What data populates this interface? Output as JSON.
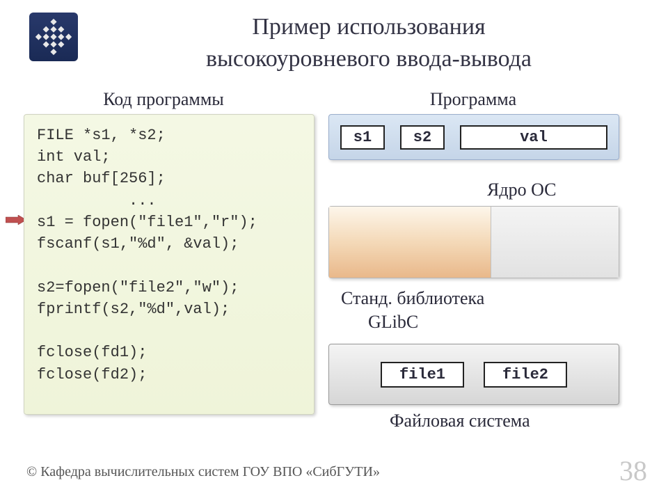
{
  "title_line1": "Пример использования",
  "title_line2": "высокоуровневого ввода-вывода",
  "labels": {
    "code": "Код программы",
    "program": "Программа",
    "kernel": "Ядро ОС",
    "glibc_line1": "Станд. библиотека",
    "glibc_line2": "GLibC",
    "filesystem": "Файловая система"
  },
  "code": "FILE *s1, *s2;\nint val;\nchar buf[256];\n          ...\ns1 = fopen(\"file1\",\"r\");\nfscanf(s1,\"%d\", &val);\n\ns2=fopen(\"file2\",\"w\");\nfprintf(s2,\"%d\",val);\n\nfclose(fd1);\nfclose(fd2);",
  "vars": {
    "s1": "s1",
    "s2": "s2",
    "val": "val"
  },
  "files": {
    "file1": "file1",
    "file2": "file2"
  },
  "footer": "© Кафедра вычислительных систем ГОУ ВПО «СибГУТИ»",
  "page": "38"
}
